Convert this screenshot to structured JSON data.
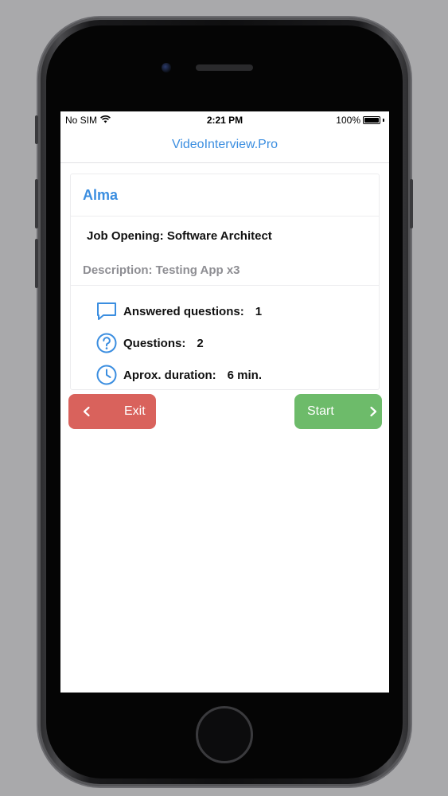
{
  "status_bar": {
    "carrier": "No SIM",
    "time": "2:21 PM",
    "battery": "100%"
  },
  "nav": {
    "title": "VideoInterview.Pro"
  },
  "card": {
    "candidate_name": "Alma",
    "job_opening": "Job Opening: Software Architect",
    "description": "Description: Testing App x3",
    "stats": [
      {
        "icon": "chat-bubble-icon",
        "label": "Answered questions:",
        "value": "1"
      },
      {
        "icon": "question-circle-icon",
        "label": "Questions:",
        "value": "2"
      },
      {
        "icon": "clock-icon",
        "label": "Aprox. duration:",
        "value": "6 min."
      }
    ]
  },
  "buttons": {
    "exit_label": "Exit",
    "start_label": "Start"
  },
  "colors": {
    "accent": "#3b8ee0",
    "exit": "#d9625c",
    "start": "#6dbb6a"
  }
}
